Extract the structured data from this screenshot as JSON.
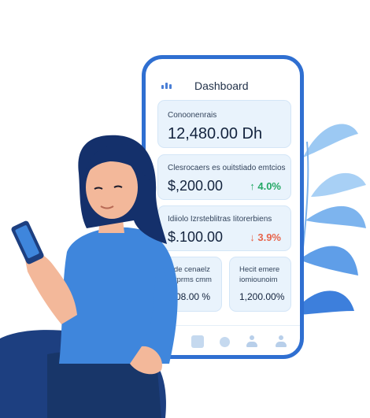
{
  "dashboard": {
    "title": "Dashboard",
    "menu_icon": "bar-chart-icon",
    "balance_card": {
      "label": "Conoonenrais",
      "value": "12,480.00 Dh"
    },
    "income_card": {
      "label": "Clesrocaers es ouitstiado emtcios",
      "value": "$,200.00",
      "change": "↑ 4.0%",
      "change_color": "#24a865"
    },
    "expense_card": {
      "label": "Idiiolo Izrsteblitras Iitorerbiens",
      "value": "$.100.00",
      "change": "↓ 3.9%",
      "change_color": "#e7644b"
    },
    "left_stat": {
      "label_line1": "e de cenaelz",
      "label_line2": "rerprms cmm",
      "value": ".708.00 %"
    },
    "right_stat": {
      "label_line1": "Hecit emere",
      "label_line2": "iomiounoim",
      "value": "1,200.00%"
    }
  },
  "navbar": {
    "items": [
      "home-icon",
      "stats-icon",
      "user-icon",
      "profile-icon"
    ]
  },
  "colors": {
    "accent": "#2f6fd1",
    "card_bg": "#e9f3fc",
    "positive": "#24a865",
    "negative": "#e7644b",
    "leaves": "#6aa8ec",
    "shirt": "#3f86dc",
    "pants": "#1d3f80"
  }
}
